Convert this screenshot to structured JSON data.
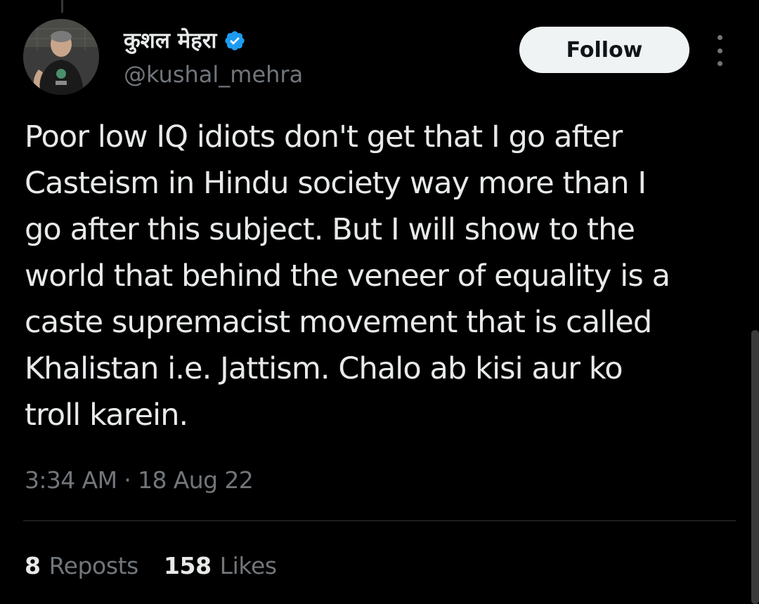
{
  "author": {
    "display_name": "कुशल मेहरा",
    "handle": "@kushal_mehra",
    "verified": true,
    "verified_color": "#1d9bf0"
  },
  "actions": {
    "follow_label": "Follow",
    "more_icon": "more-vertical-icon"
  },
  "tweet": {
    "lines": [
      "Poor low IQ idiots don't get that I go after",
      "Casteism in Hindu society way more than I",
      "go after this subject. But I will show to the",
      "world that behind the veneer of equality is a",
      "caste supremacist movement that is called",
      "Khalistan i.e. Jattism. Chalo ab kisi aur ko",
      "troll karein."
    ],
    "timestamp": "3:34 AM · 18 Aug 22"
  },
  "stats": {
    "reposts_count": "8",
    "reposts_label": "Reposts",
    "likes_count": "158",
    "likes_label": "Likes"
  },
  "colors": {
    "background": "#000000",
    "text_primary": "#e7e9ea",
    "text_secondary": "#71767b",
    "divider": "#2f3336",
    "follow_bg": "#eff3f4"
  }
}
